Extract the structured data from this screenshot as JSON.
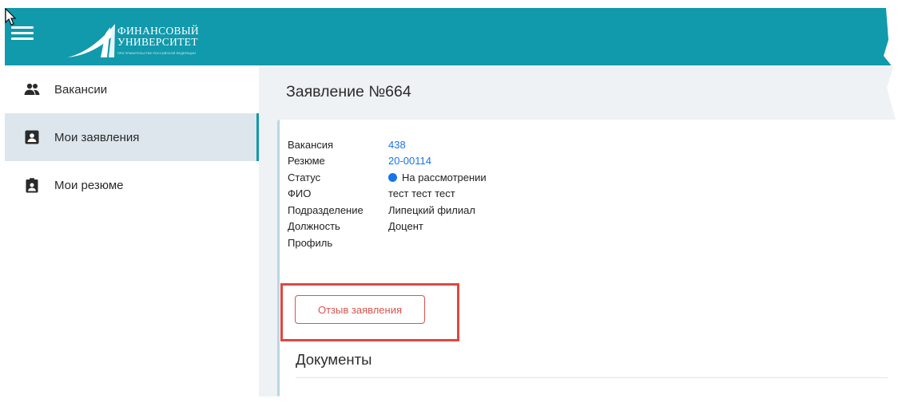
{
  "header": {
    "logo_line1": "ФИНАНСОВЫЙ",
    "logo_line2": "УНИВЕРСИТЕТ",
    "logo_subtitle": "ПРИ ПРАВИТЕЛЬСТВЕ РОССИЙСКОЙ ФЕДЕРАЦИИ",
    "brand_color": "#1199ac"
  },
  "sidebar": {
    "items": [
      {
        "label": "Вакансии",
        "icon": "people-icon",
        "active": false
      },
      {
        "label": "Мои заявления",
        "icon": "contact-card-icon",
        "active": true
      },
      {
        "label": "Мои резюме",
        "icon": "clipboard-person-icon",
        "active": false
      }
    ]
  },
  "main": {
    "title": "Заявление №664",
    "fields": [
      {
        "label": "Вакансия",
        "value": "438"
      },
      {
        "label": "Резюме",
        "value": "20-00114"
      },
      {
        "label": "Статус",
        "value": "На рассмотрении"
      },
      {
        "label": "ФИО",
        "value": "тест тест тест"
      },
      {
        "label": "Подразделение",
        "value": "Липецкий филиал"
      },
      {
        "label": "Должность",
        "value": "Доцент"
      },
      {
        "label": "Профиль",
        "value": ""
      }
    ],
    "withdraw_button": "Отзыв заявления",
    "documents_title": "Документы"
  }
}
